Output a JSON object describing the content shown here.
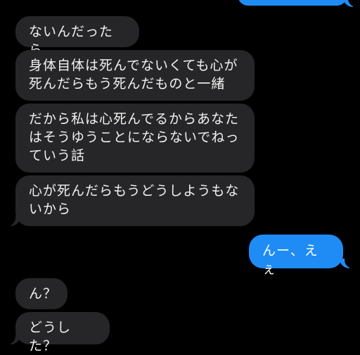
{
  "messages": [
    {
      "side": "incoming",
      "text": "ないんだったら"
    },
    {
      "side": "incoming",
      "text": "身体自体は死んでないくても心が\n死んだらもう死んだものと一緒"
    },
    {
      "side": "incoming",
      "text": "だから私は心死んでるからあなた\nはそうゆうことにならないでねっ\nていう話"
    },
    {
      "side": "incoming",
      "text": "心が死んだらもうどうしようもな\nいから"
    },
    {
      "side": "outgoing",
      "text": "んー、えぇ"
    },
    {
      "side": "incoming",
      "text": "ん？"
    },
    {
      "side": "incoming",
      "text": "どうした？"
    }
  ],
  "colors": {
    "background": "#000000",
    "incoming_bubble": "#262628",
    "outgoing_bubble": "#1f8cf5",
    "text": "#f2f2f2"
  }
}
